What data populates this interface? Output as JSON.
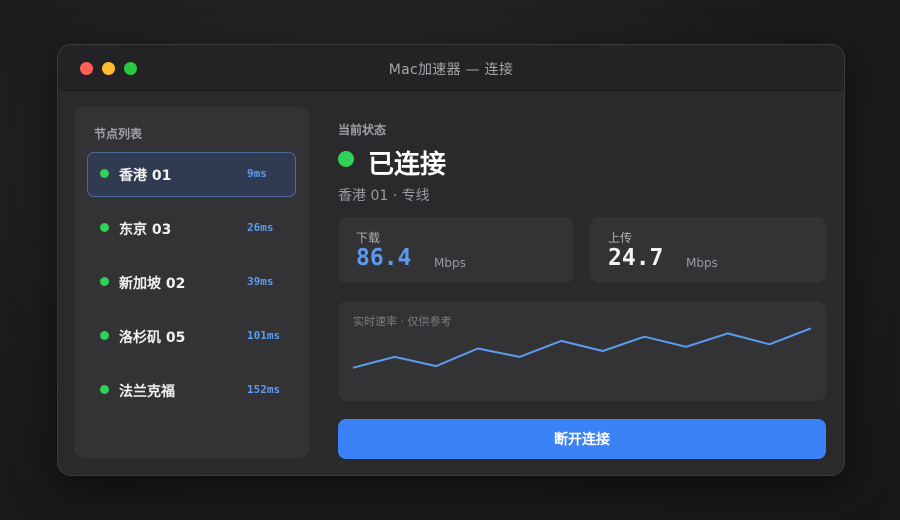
{
  "window": {
    "title": "Mac加速器 — 连接"
  },
  "sidebar": {
    "title": "节点列表",
    "items": [
      {
        "name": "香港 01",
        "latency": "9ms",
        "active": true
      },
      {
        "name": "东京 03",
        "latency": "26ms",
        "active": false
      },
      {
        "name": "新加坡 02",
        "latency": "39ms",
        "active": false
      },
      {
        "name": "洛杉矶 05",
        "latency": "101ms",
        "active": false
      },
      {
        "name": "法兰克福",
        "latency": "152ms",
        "active": false
      }
    ]
  },
  "status": {
    "label": "当前状态",
    "text": "已连接",
    "sub": "香港 01 · 专线",
    "color": "#30d158"
  },
  "download": {
    "label": "下载",
    "value": "86.4",
    "unit": "Mbps",
    "color": "#5b9cf0"
  },
  "upload": {
    "label": "上传",
    "value": "24.7",
    "unit": "Mbps"
  },
  "chart": {
    "label": "实时速率 · 仅供参考",
    "values": [
      30,
      43,
      32,
      53,
      43,
      62,
      50,
      67,
      55,
      71,
      58,
      77
    ],
    "ylim": [
      0,
      100
    ],
    "color": "#5b9cf0"
  },
  "action": {
    "disconnect_label": "断开连接",
    "color": "#3b82f6"
  }
}
